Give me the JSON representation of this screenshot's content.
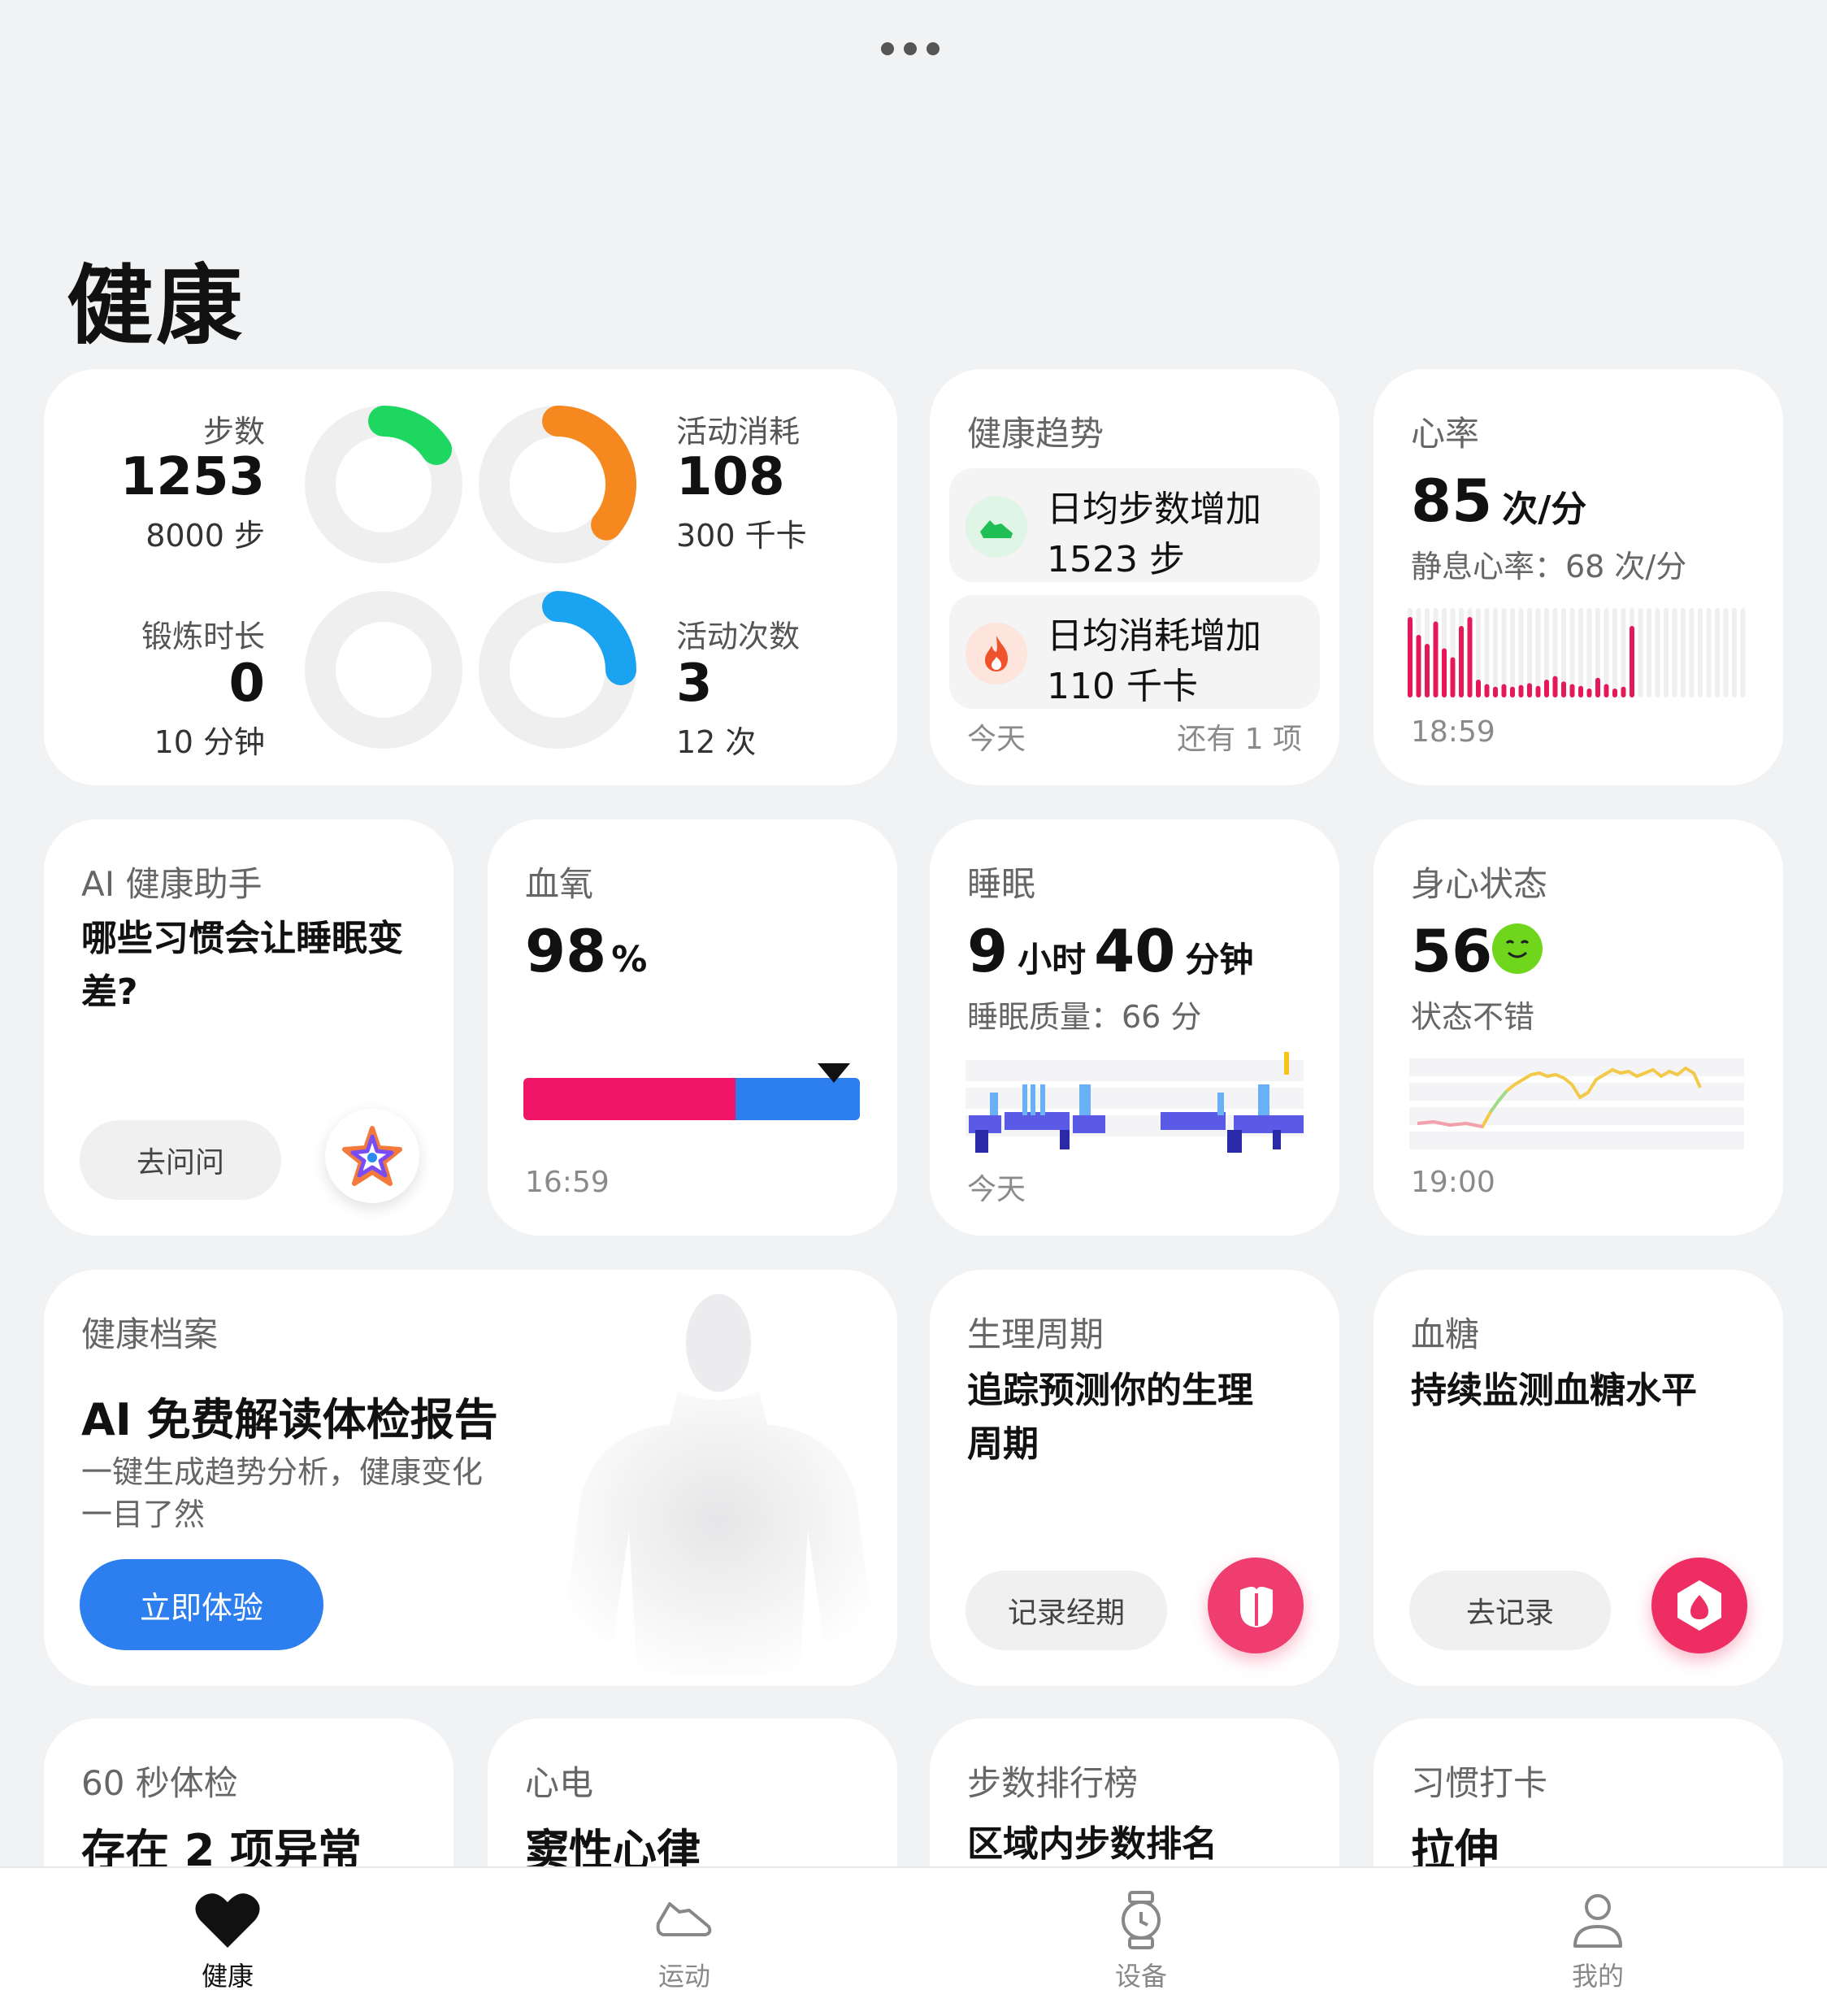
{
  "page_title": "健康",
  "activity": {
    "steps": {
      "label": "步数",
      "value": "1253",
      "goal": "8000 步",
      "progress": 0.157,
      "color": "#1ed760"
    },
    "calories": {
      "label": "活动消耗",
      "value": "108",
      "goal": "300 千卡",
      "progress": 0.36,
      "color": "#f5891f"
    },
    "exercise": {
      "label": "锻炼时长",
      "value": "0",
      "goal": "10 分钟",
      "progress": 0.0,
      "color": "#f5891f"
    },
    "active": {
      "label": "活动次数",
      "value": "3",
      "goal": "12 次",
      "progress": 0.25,
      "color": "#1aa3f0"
    }
  },
  "trend": {
    "title": "健康趋势",
    "items": [
      {
        "line1": "日均步数增加",
        "line2": "1523 步",
        "icon": "shoe-icon"
      },
      {
        "line1": "日均消耗增加",
        "line2": "110 千卡",
        "icon": "flame-icon"
      }
    ],
    "footer_left": "今天",
    "footer_right": "还有 1 项"
  },
  "heart": {
    "title": "心率",
    "value": "85",
    "unit": "次/分",
    "resting": "静息心率：68 次/分",
    "time": "18:59",
    "bar_color": "#e5195a",
    "series": [
      0.9,
      0.7,
      0.6,
      0.85,
      0.55,
      0.45,
      0.8,
      0.9,
      0.2,
      0.15,
      0.12,
      0.15,
      0.12,
      0.14,
      0.16,
      0.13,
      0.2,
      0.24,
      0.18,
      0.15,
      0.13,
      0.1,
      0.22,
      0.15,
      0.1,
      0.12,
      0.8
    ]
  },
  "ai": {
    "title": "AI 健康助手",
    "question": "哪些习惯会让睡眠变差?",
    "button": "去问问",
    "icon": "ai-star-icon"
  },
  "spo2": {
    "title": "血氧",
    "value": "98",
    "unit": "%",
    "time": "16:59",
    "level": 0.98
  },
  "sleep": {
    "title": "睡眠",
    "hours": "9",
    "hours_unit": "小时",
    "minutes": "40",
    "minutes_unit": "分钟",
    "quality": "睡眠质量：66 分",
    "footer": "今天"
  },
  "mood": {
    "title": "身心状态",
    "value": "56",
    "status": "状态不错",
    "time": "19:00",
    "icon": "smiley-icon"
  },
  "record": {
    "title": "健康档案",
    "headline": "AI 免费解读体检报告",
    "desc1": "一键生成趋势分析，健康变化",
    "desc2": "一目了然",
    "button": "立即体验"
  },
  "cycle": {
    "title": "生理周期",
    "text1": "追踪预测你的生理",
    "text2": "周期",
    "button": "记录经期",
    "icon": "petal-icon"
  },
  "glucose": {
    "title": "血糖",
    "text": "持续监测血糖水平",
    "button": "去记录",
    "icon": "drop-icon"
  },
  "check60": {
    "title": "60 秒体检",
    "text": "存在 2 项异常"
  },
  "ecg": {
    "title": "心电",
    "text": "窦性心律"
  },
  "ranking": {
    "title": "步数排行榜",
    "text": "区域内步数排名"
  },
  "habit": {
    "title": "习惯打卡",
    "text": "拉伸"
  },
  "nav": {
    "health": "健康",
    "sport": "运动",
    "device": "设备",
    "mine": "我的"
  }
}
